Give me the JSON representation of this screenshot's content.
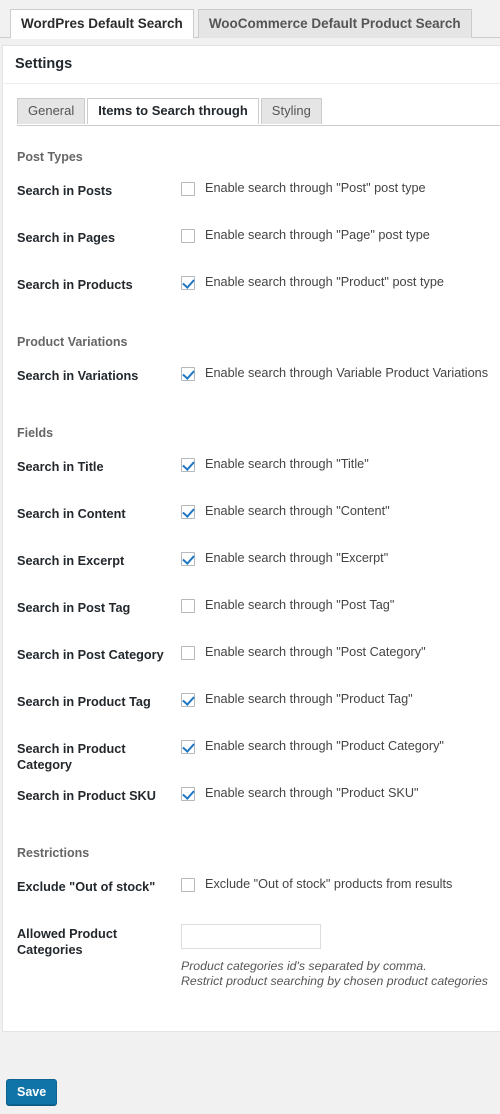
{
  "top_tabs": [
    {
      "label": "WordPres Default Search",
      "active": true
    },
    {
      "label": "WooCommerce Default Product Search",
      "active": false
    }
  ],
  "panel": {
    "title": "Settings"
  },
  "sub_tabs": [
    {
      "label": "General",
      "active": false
    },
    {
      "label": "Items to Search through",
      "active": true
    },
    {
      "label": "Styling",
      "active": false
    }
  ],
  "sections": {
    "post_types": {
      "title": "Post Types",
      "rows": [
        {
          "label": "Search in Posts",
          "checkbox_text": "Enable search through \"Post\" post type",
          "checked": false
        },
        {
          "label": "Search in Pages",
          "checkbox_text": "Enable search through \"Page\" post type",
          "checked": false
        },
        {
          "label": "Search in Products",
          "checkbox_text": "Enable search through \"Product\" post type",
          "checked": true
        }
      ]
    },
    "product_variations": {
      "title": "Product Variations",
      "rows": [
        {
          "label": "Search in Variations",
          "checkbox_text": "Enable search through Variable Product Variations",
          "checked": true
        }
      ]
    },
    "fields": {
      "title": "Fields",
      "rows": [
        {
          "label": "Search in Title",
          "checkbox_text": "Enable search through \"Title\"",
          "checked": true
        },
        {
          "label": "Search in Content",
          "checkbox_text": "Enable search through \"Content\"",
          "checked": true
        },
        {
          "label": "Search in Excerpt",
          "checkbox_text": "Enable search through \"Excerpt\"",
          "checked": true
        },
        {
          "label": "Search in Post Tag",
          "checkbox_text": "Enable search through \"Post Tag\"",
          "checked": false
        },
        {
          "label": "Search in Post Category",
          "checkbox_text": "Enable search through \"Post Category\"",
          "checked": false
        },
        {
          "label": "Search in Product Tag",
          "checkbox_text": "Enable search through \"Product Tag\"",
          "checked": true
        },
        {
          "label": "Search in Product Category",
          "checkbox_text": "Enable search through \"Product Category\"",
          "checked": true
        },
        {
          "label": "Search in Product SKU",
          "checkbox_text": "Enable search through \"Product SKU\"",
          "checked": true
        }
      ]
    },
    "restrictions": {
      "title": "Restrictions",
      "out_of_stock": {
        "label": "Exclude \"Out of stock\"",
        "checkbox_text": "Exclude \"Out of stock\" products from results",
        "checked": false
      },
      "allowed_categories": {
        "label": "Allowed Product Categories",
        "value": "",
        "placeholder": "",
        "help_line_1": "Product categories id's separated by comma.",
        "help_line_2": "Restrict product searching by chosen product categories"
      }
    }
  },
  "footer": {
    "save_label": "Save"
  },
  "colors": {
    "accent": "#1074a8",
    "checkmark": "#1f77c4",
    "page_background": "#f1f1f1",
    "panel_background": "#ffffff",
    "section_title": "#666666",
    "label": "#23282d"
  }
}
